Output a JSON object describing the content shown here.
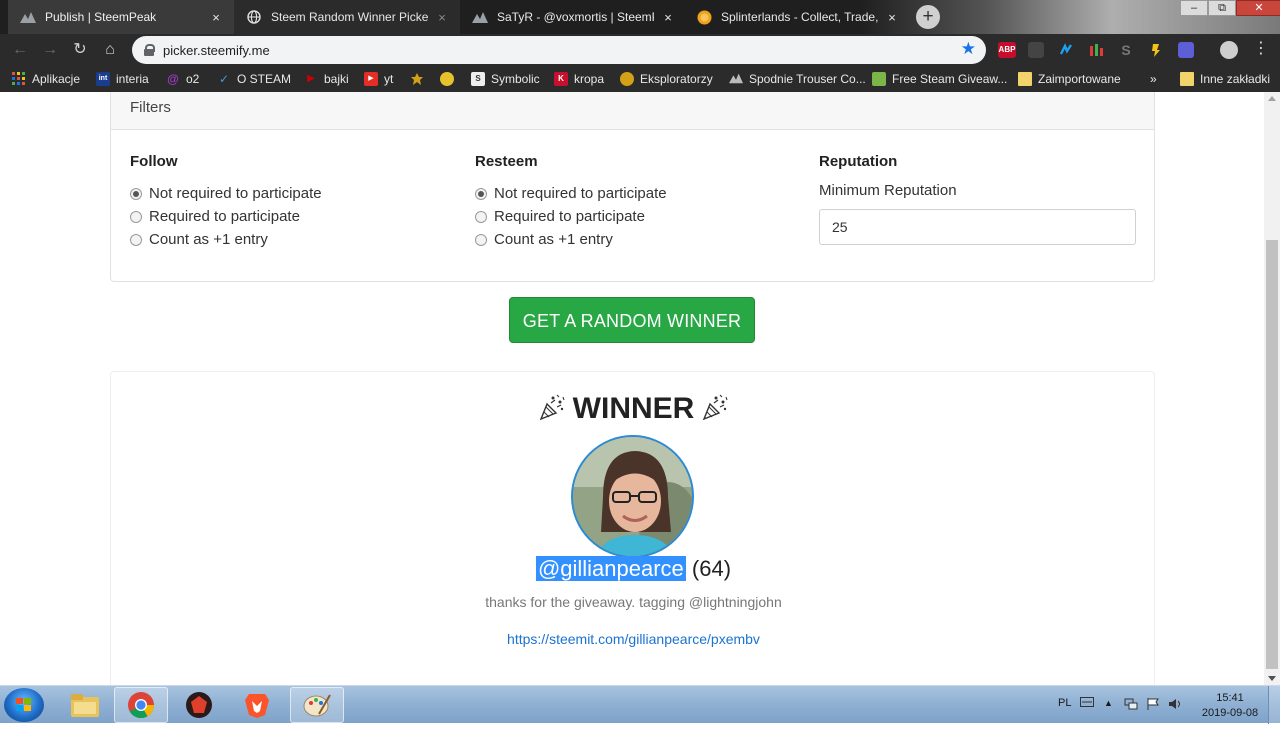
{
  "browser": {
    "tabs": [
      {
        "title": "Publish | SteemPeak",
        "close": "×",
        "icon": "steempeak-icon"
      },
      {
        "title": "Steem Random Winner Picker",
        "close": "×",
        "icon": "globe-icon"
      },
      {
        "title": "SaTyR - @voxmortis | SteemPeak",
        "close": "×",
        "icon": "steempeak-icon"
      },
      {
        "title": "Splinterlands - Collect, Trade, Ba",
        "close": "×",
        "icon": "splinterlands-icon"
      }
    ],
    "new_tab": "+",
    "window_controls": {
      "minimize": "–",
      "maximize": "⧉",
      "close": "✕"
    },
    "nav": {
      "back": "←",
      "forward": "→",
      "reload": "↻",
      "home": "⌂"
    },
    "url": "picker.steemify.me",
    "bookmark_star": "★",
    "extensions": [
      {
        "name": "adblock-plus-icon",
        "label": "ABP",
        "color": "#c70d2c"
      },
      {
        "name": "extension-2-icon",
        "label": "",
        "color": "#444"
      },
      {
        "name": "extension-3-icon",
        "label": "",
        "color": "#1da1f2"
      },
      {
        "name": "extension-4-icon",
        "label": "",
        "color": "#e03a3a"
      },
      {
        "name": "extension-5-icon",
        "label": "S",
        "color": "#555"
      },
      {
        "name": "extension-6-icon",
        "label": "",
        "color": "#f2c318"
      },
      {
        "name": "extension-7-icon",
        "label": "",
        "color": "#5e5ed6"
      },
      {
        "name": "account-icon",
        "label": "",
        "color": "#888"
      }
    ],
    "menu": "⋮"
  },
  "bookmarks": [
    {
      "label": "Aplikacje",
      "icon": "apps-grid-icon",
      "color": "#e0543a"
    },
    {
      "label": "interia",
      "icon": "interia-icon",
      "color": "#1a3d8f",
      "glyph": "int"
    },
    {
      "label": "o2",
      "icon": "o2-icon",
      "color": "#a13cc7",
      "glyph": "@"
    },
    {
      "label": "O STEAM",
      "icon": "steam-icon",
      "color": "#1b6fb0",
      "glyph": "✓"
    },
    {
      "label": "bajki",
      "icon": "play-icon",
      "color": "#cc0000",
      "glyph": "▶"
    },
    {
      "label": "yt",
      "icon": "youtube-icon",
      "color": "#e52d27",
      "glyph": "▶"
    },
    {
      "label": "",
      "icon": "bookmark-icon-7",
      "color": "#d4a017",
      "glyph": ""
    },
    {
      "label": "",
      "icon": "bookmark-icon-8",
      "color": "#e8c22d",
      "glyph": ""
    },
    {
      "label": "Symbolic",
      "icon": "symbolic-icon",
      "color": "#666",
      "glyph": "S"
    },
    {
      "label": "kropa",
      "icon": "kropa-icon",
      "color": "#c8102e",
      "glyph": "K"
    },
    {
      "label": "Eksploratorzy",
      "icon": "eksploratorzy-icon",
      "color": "#d4a017",
      "glyph": ""
    },
    {
      "label": "Spodnie Trouser Co...",
      "icon": "steempeak-bm-icon",
      "color": "#777",
      "glyph": ""
    },
    {
      "label": "Free Steam Giveaw...",
      "icon": "giveaway-icon",
      "color": "#7ab648",
      "glyph": ""
    },
    {
      "label": "Zaimportowane",
      "icon": "folder-icon",
      "color": "#f2d36b",
      "glyph": ""
    },
    {
      "label": "»",
      "icon": "more-bookmarks-icon",
      "color": "",
      "glyph": ""
    },
    {
      "label": "Inne zakładki",
      "icon": "folder-icon",
      "color": "#f2d36b",
      "glyph": ""
    }
  ],
  "filters": {
    "header": "Filters",
    "follow": {
      "title": "Follow",
      "options": [
        "Not required to participate",
        "Required to participate",
        "Count as +1 entry"
      ],
      "selected": 0
    },
    "resteem": {
      "title": "Resteem",
      "options": [
        "Not required to participate",
        "Required to participate",
        "Count as +1 entry"
      ],
      "selected": 0
    },
    "reputation": {
      "title": "Reputation",
      "label": "Minimum Reputation",
      "value": "25"
    }
  },
  "action": {
    "label": "GET A RANDOM WINNER"
  },
  "winner": {
    "title": "WINNER",
    "confetti_icon": "party-popper-icon",
    "username": "@gillianpearce",
    "reputation": "(64)",
    "comment": "thanks for the giveaway. tagging @lightningjohn",
    "link": "https://steemit.com/gillianpearce/pxembv"
  },
  "taskbar": {
    "apps": [
      "explorer-icon",
      "chrome-icon",
      "brave-bat-icon",
      "brave-icon",
      "paint-icon"
    ],
    "tray": {
      "language": "PL",
      "time": "15:41",
      "date": "2019-09-08"
    }
  }
}
